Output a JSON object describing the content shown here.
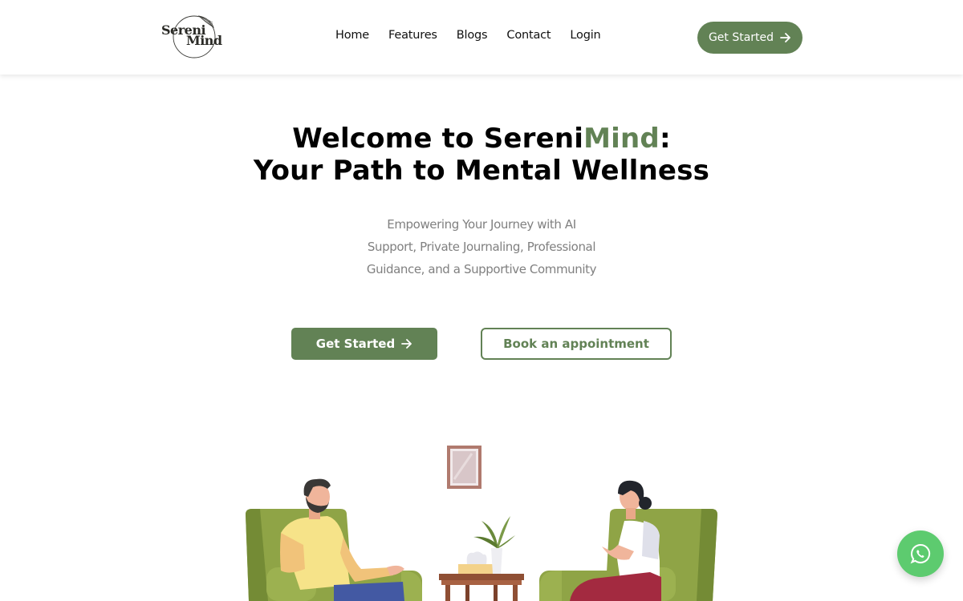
{
  "brand": {
    "name_line1": "Sereni",
    "name_line2": "Mind",
    "accent_color": "#628255"
  },
  "nav": {
    "links": [
      {
        "label": "Home"
      },
      {
        "label": "Features"
      },
      {
        "label": "Blogs"
      },
      {
        "label": "Contact"
      },
      {
        "label": "Login"
      }
    ],
    "cta_label": "Get Started",
    "cta_icon": "arrow-right-icon"
  },
  "hero": {
    "title_part1": "Welcome to Sereni",
    "title_accent": "Mind",
    "title_part2": ":",
    "title_line2": "Your Path to Mental Wellness",
    "subtitle": "Empowering Your Journey with AI Support, Private Journaling, Professional Guidance, and a Supportive Community",
    "primary_button": "Get Started",
    "secondary_button": "Book an appointment"
  },
  "illustration": {
    "description": "Therapy session: man and woman seated in green armchairs with a side table, plant, tissue box and framed picture"
  },
  "floating": {
    "whatsapp_icon": "whatsapp-icon",
    "whatsapp_color": "#5dcb6f"
  }
}
